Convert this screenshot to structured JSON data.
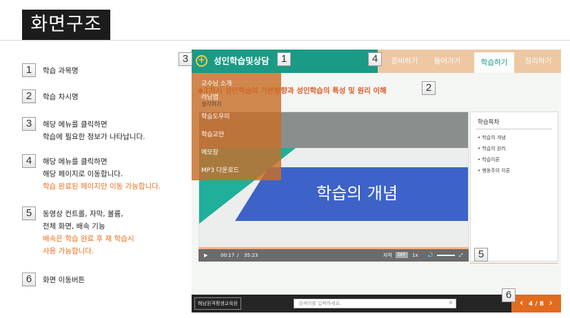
{
  "title": "화면구조",
  "legend": [
    {
      "num": "1",
      "lines": [
        "학습 과목명"
      ],
      "highlight": []
    },
    {
      "num": "2",
      "lines": [
        "학습 차시명"
      ],
      "highlight": []
    },
    {
      "num": "3",
      "lines": [
        "해당 메뉴를 클릭하면",
        "학습에 필요한 정보가 나타납니다."
      ],
      "highlight": []
    },
    {
      "num": "4",
      "lines": [
        "해당 메뉴를 클릭하면",
        "해당 페이지로 이동합니다."
      ],
      "highlight": [
        "학습 완료된 페이지만 이동 가능합니다."
      ]
    },
    {
      "num": "5",
      "lines": [
        "동영상 컨트롤, 자막, 볼륨,",
        "전체 화면, 배속 기능"
      ],
      "highlight": [
        "배속은 학습 완료 후 재 학습시",
        "사용 가능합니다."
      ]
    },
    {
      "num": "6",
      "lines": [
        "화면 이동버튼"
      ],
      "highlight": []
    }
  ],
  "screen": {
    "course_title": "성인학습및상담",
    "lesson_title": "1차시 성인학습의 기본방향과 성인학습의 특성 및 원리 이해",
    "tabs": [
      "준비하기",
      "들어가기",
      "학습하기",
      "정리하기"
    ],
    "active_tab": "학습하기",
    "menu": [
      "교수님 소개",
      "러닝맵",
      "학습도우미",
      "학습교안",
      "메모장",
      "MP3 다운로드"
    ],
    "menu_sub": "생각하기",
    "video_title": "학습의 개념",
    "time_current": "00:17",
    "time_sep": "/",
    "time_total": "35:23",
    "subtitle_label": "자막",
    "subtitle_state": "OFF",
    "speed": "1x",
    "toc_title": "학습목차",
    "toc": [
      "학습의 개념",
      "학습의 원리",
      "학습이론",
      "행동주의 이론"
    ],
    "search_placeholder": "검색어를 입력하세요.",
    "logo_text": "해남원격평생교육원",
    "page": "4 / 8"
  },
  "callouts": [
    "3",
    "1",
    "4",
    "2",
    "5",
    "6"
  ],
  "colors": {
    "teal": "#1b9a86",
    "orange": "#e26b1e",
    "highlight": "#ef6d1c"
  }
}
